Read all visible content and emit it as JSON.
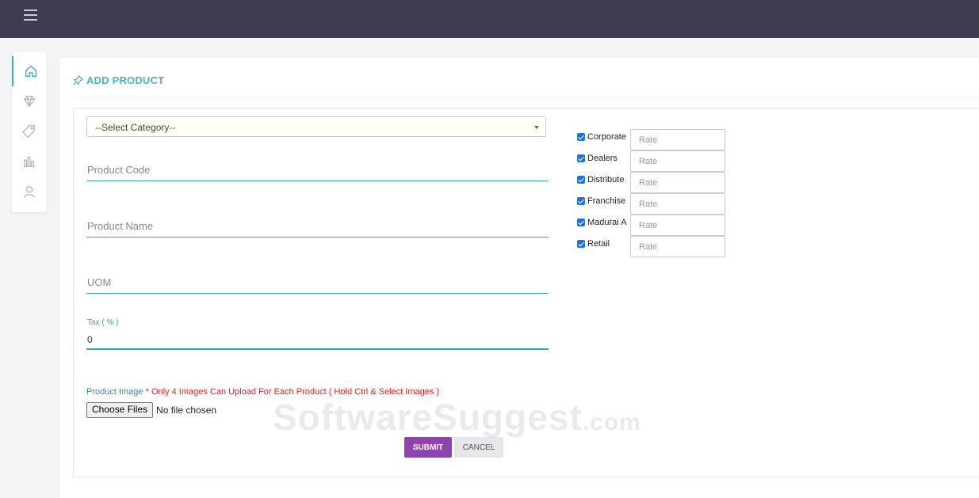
{
  "topbar": {
    "menu_icon": "hamburger-icon"
  },
  "sidebar": {
    "items": [
      {
        "icon": "home-icon",
        "active": true
      },
      {
        "icon": "diamond-icon"
      },
      {
        "icon": "tag-icon"
      },
      {
        "icon": "bar-chart-icon"
      },
      {
        "icon": "user-icon"
      }
    ]
  },
  "header": {
    "title": "ADD PRODUCT",
    "icon": "pin-icon"
  },
  "form": {
    "category_select": "--Select Category--",
    "product_code_placeholder": "Product Code",
    "product_name_placeholder": "Product Name",
    "uom_placeholder": "UOM",
    "tax_label": "Tax ( % )",
    "tax_value": "0",
    "image_label": "Product Image",
    "image_note": "* Only 4 Images Can Upload For Each Product ( Hold Ctrl & Select Images )",
    "choose_files": "Choose Files",
    "no_file": "No file chosen",
    "submit": "SUBMIT",
    "cancel": "CANCEL"
  },
  "rates": [
    {
      "label": "Corporate",
      "placeholder": "Rate",
      "checked": true
    },
    {
      "label": "Dealers",
      "placeholder": "Rate",
      "checked": true
    },
    {
      "label": "Distribute",
      "placeholder": "Rate",
      "checked": true
    },
    {
      "label": "Franchise",
      "placeholder": "Rate",
      "checked": true
    },
    {
      "label": "Madurai A",
      "placeholder": "Rate",
      "checked": true
    },
    {
      "label": "Retail",
      "placeholder": "Rate",
      "checked": true
    }
  ],
  "watermark": {
    "main": "SoftwareSuggest",
    "suffix": ".com"
  },
  "colors": {
    "topbar": "#3c3e50",
    "accent": "#45b4c4",
    "submit": "#8e44ad"
  }
}
